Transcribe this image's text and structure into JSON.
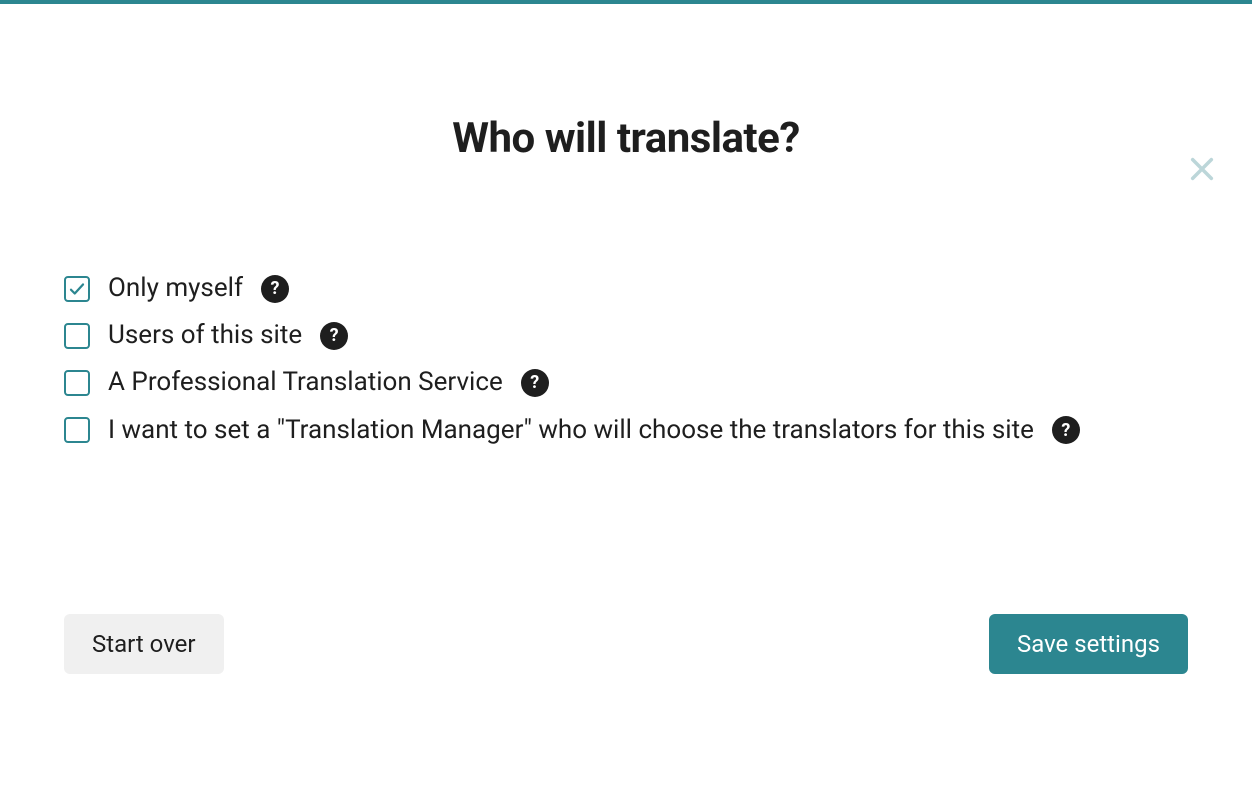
{
  "colors": {
    "accent": "#2c8690",
    "text": "#1e1e1e",
    "closeIcon": "#bcd6d9",
    "secondaryBg": "#f0f0f0"
  },
  "title": "Who will translate?",
  "options": [
    {
      "label": "Only myself",
      "checked": true,
      "help": true
    },
    {
      "label": "Users of this site",
      "checked": false,
      "help": true
    },
    {
      "label": "A Professional Translation Service",
      "checked": false,
      "help": true
    },
    {
      "label": "I want to set a \"Translation Manager\" who will choose the translators for this site",
      "checked": false,
      "help": true
    }
  ],
  "buttons": {
    "start_over": "Start over",
    "save": "Save settings"
  },
  "help_glyph": "?"
}
